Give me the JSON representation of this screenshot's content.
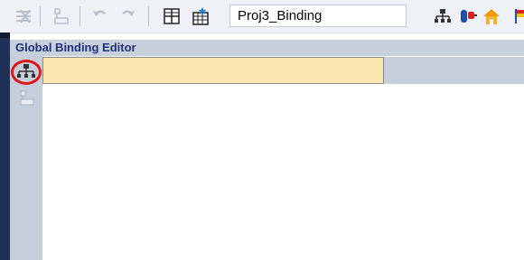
{
  "toolbar": {
    "project_name": "Proj3_Binding",
    "icons": [
      "delete-disabled-icon",
      "insert-disabled-icon",
      "undo-icon",
      "redo-icon",
      "table-icon",
      "grid-new-icon",
      "network-icon",
      "tag-icon",
      "home-icon",
      "flag-icon"
    ]
  },
  "editor": {
    "title": "Global Binding Editor",
    "row_value": ""
  },
  "colors": {
    "row_fill": "#fde7b1",
    "header_bg": "#c7d0dc",
    "title_color": "#20307a",
    "highlight": "#e01717",
    "sidebar": "#1f2f55"
  }
}
